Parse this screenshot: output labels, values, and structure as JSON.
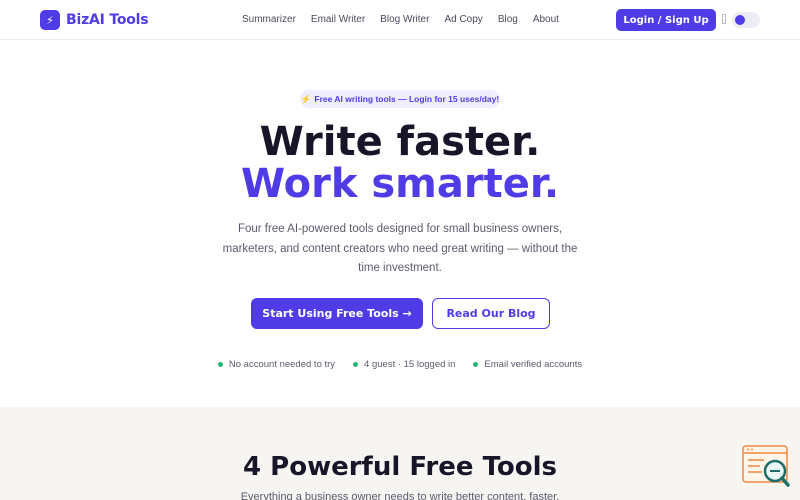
{
  "header": {
    "logo_icon": "⚡",
    "logo_text": "BizAI Tools",
    "nav": [
      "Summarizer",
      "Email Writer",
      "Blog Writer",
      "Ad Copy",
      "Blog",
      "About"
    ],
    "login_label": "Login / Sign Up",
    "theme_toggle": {
      "state": "on"
    }
  },
  "hero": {
    "badge_icon": "⚡",
    "badge_text": "Free AI writing tools — Login for 15 uses/day!",
    "title_line1": "Write faster.",
    "title_line2": "Work smarter.",
    "subtitle": "Four free AI-powered tools designed for small business owners, marketers, and content creators who need great writing — without the time investment.",
    "primary_button": "Start Using Free Tools →",
    "secondary_button": "Read Our Blog",
    "features": [
      "No account needed to try",
      "4 guest · 15 logged in",
      "Email verified accounts"
    ]
  },
  "tools_section": {
    "title": "4 Powerful Free Tools",
    "subtitle": "Everything a business owner needs to write better content, faster."
  },
  "colors": {
    "accent": "#4f3ce6",
    "heading": "#171629",
    "success": "#22b573",
    "section_bg": "#f6f5f2"
  },
  "icons": {
    "logo": "lightning-icon",
    "badge": "lightning-icon",
    "widget": "search-help-widget-icon"
  }
}
